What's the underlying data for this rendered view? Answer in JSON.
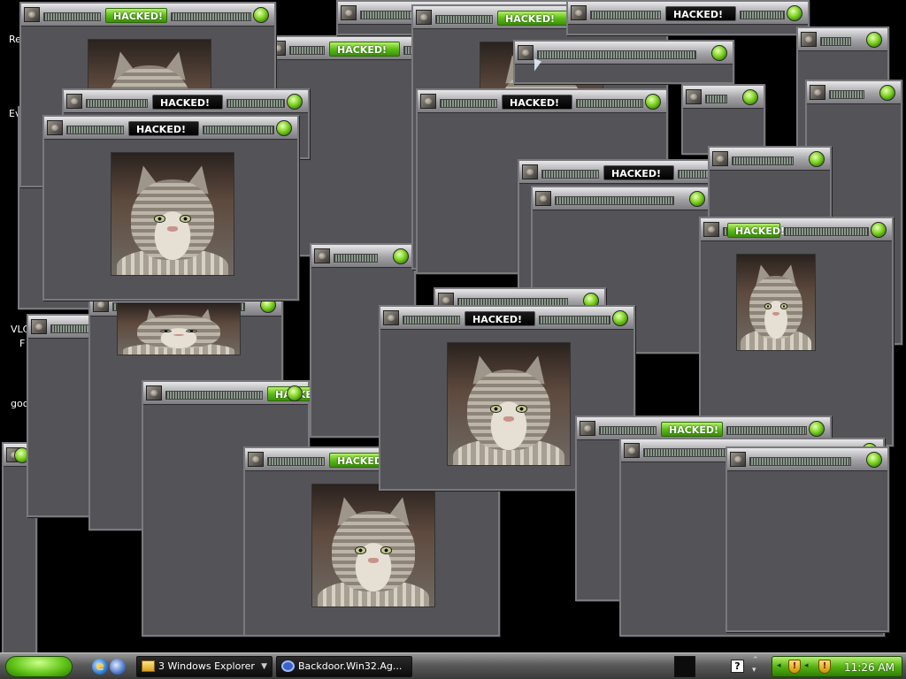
{
  "desktop": {
    "icon_labels": [
      "Re",
      "Ev",
      "VLC",
      "F",
      "goo"
    ]
  },
  "popup": {
    "title_label": "HACKED!",
    "photo_subject": "tabby-cat-photo",
    "button_color": "#7ed321"
  },
  "taskbar": {
    "start_color": "#5cbf17",
    "buttons": [
      {
        "label": "3 Windows Explorer",
        "icon": "folder-icon"
      },
      {
        "label": "Backdoor.Win32.Ag...",
        "icon": "backdoor-icon"
      }
    ],
    "help_label": "?",
    "tray_icons": [
      "shield-alert-icon",
      "shield-alert-icon"
    ],
    "shield_mark": "!",
    "clock": "11:26 AM"
  }
}
